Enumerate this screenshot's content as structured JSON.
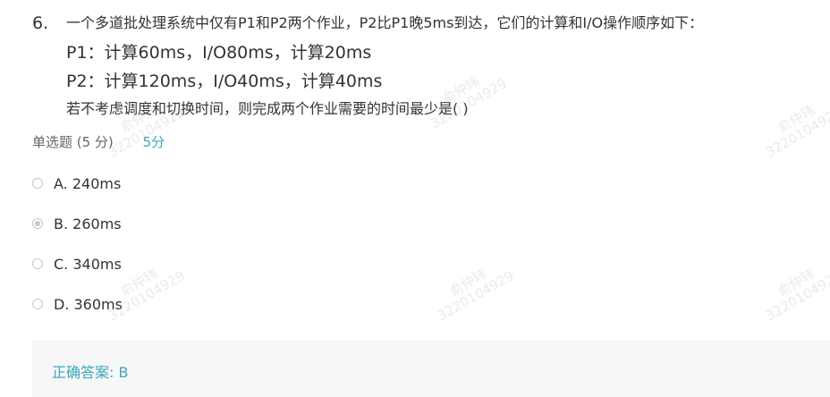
{
  "question": {
    "number": "6.",
    "lines": [
      "一个多道批处理系统中仅有P1和P2两个作业，P2比P1晚5ms到达，它们的计算和I/O操作顺序如下：",
      "P1：计算60ms，I/O80ms，计算20ms",
      "P2：计算120ms，I/O40ms，计算40ms",
      "若不考虑调度和切换时间，则完成两个作业需要的时间最少是( )"
    ]
  },
  "meta": {
    "type_label": "单选题 (5 分)",
    "score": "5分"
  },
  "options": [
    {
      "label": "A. 240ms",
      "selected": false
    },
    {
      "label": "B. 260ms",
      "selected": true
    },
    {
      "label": "C. 340ms",
      "selected": false
    },
    {
      "label": "D. 360ms",
      "selected": false
    }
  ],
  "answer": {
    "text": "正确答案: B"
  },
  "watermark": {
    "name": "俞仲玮",
    "id": "3220104929"
  },
  "colors": {
    "accent": "#3aa8b8",
    "answer_bg": "#f7f7f7"
  }
}
